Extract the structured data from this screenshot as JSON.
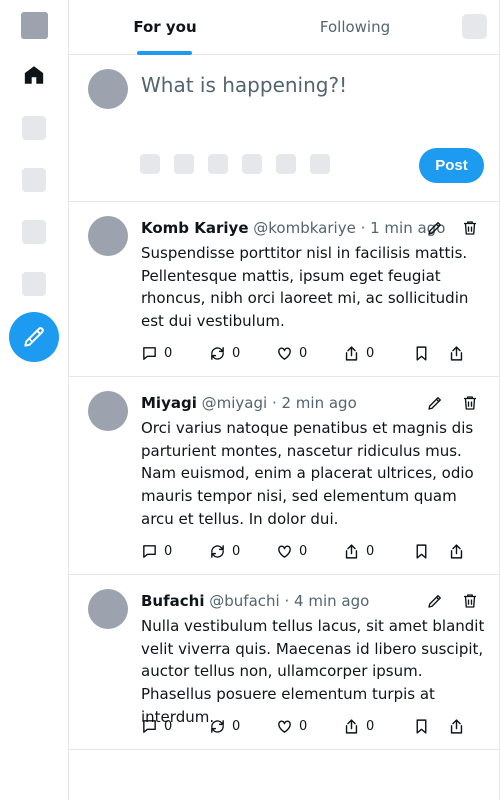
{
  "nav": {
    "tabs": [
      {
        "label": "For you"
      },
      {
        "label": "Following"
      }
    ]
  },
  "composer": {
    "placeholder": "What is happening?!",
    "post_label": "Post"
  },
  "tweets": [
    {
      "name": "Komb Kariye",
      "handle": "@kombkariye",
      "time": "1 min ago",
      "text": "Suspendisse porttitor nisl in facilisis mattis. Pellentesque mattis, ipsum eget feugiat rhoncus, nibh orci laoreet mi, ac sollicitudin est dui vestibulum.",
      "replies": "0",
      "retweets": "0",
      "likes": "0",
      "views": "0"
    },
    {
      "name": "Miyagi",
      "handle": "@miyagi",
      "time": "2 min ago",
      "text": "Orci varius natoque penatibus et magnis dis parturient montes, nascetur ridiculus mus. Nam euismod, enim a placerat ultrices, odio mauris tempor nisi, sed elementum quam arcu et tellus. In dolor dui.",
      "replies": "0",
      "retweets": "0",
      "likes": "0",
      "views": "0"
    },
    {
      "name": "Bufachi",
      "handle": "@bufachi",
      "time": "4 min ago",
      "text": "Nulla vestibulum tellus lacus, sit amet blandit velit viverra quis. Maecenas id libero suscipit, auctor tellus non, ullamcorper ipsum. Phasellus posuere elementum turpis at interdum.",
      "replies": "0",
      "retweets": "0",
      "likes": "0",
      "views": "0"
    }
  ],
  "icons": {
    "sidebar": [
      "logo-icon",
      "home-icon",
      "explore-icon",
      "notifications-icon",
      "messages-icon",
      "profile-icon",
      "compose-icon"
    ],
    "tweet_actions": [
      "reply-icon",
      "retweet-icon",
      "like-icon",
      "views-icon",
      "bookmark-icon",
      "share-icon"
    ],
    "tweet_tools": [
      "edit-icon",
      "delete-icon"
    ]
  },
  "colors": {
    "accent": "#1d9bf0",
    "placeholder_gray": "#9ca3af",
    "divider": "#e5e7eb",
    "secondary_text": "#536471"
  }
}
